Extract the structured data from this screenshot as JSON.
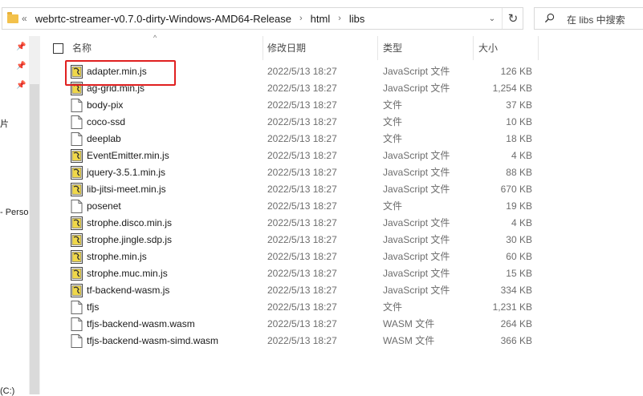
{
  "address_bar": {
    "overflow_chevron": "«",
    "crumbs": [
      "webrtc-streamer-v0.7.0-dirty-Windows-AMD64-Release",
      "html",
      "libs"
    ],
    "separator": "›",
    "dropdown_glyph": "⌄",
    "refresh_glyph": "↻"
  },
  "search": {
    "placeholder": "在 libs 中搜索"
  },
  "nav": {
    "fragments": [
      "片",
      "- Perso",
      "(C:)"
    ]
  },
  "columns": {
    "name": "名称",
    "date": "修改日期",
    "type": "类型",
    "size": "大小"
  },
  "files": [
    {
      "name": "adapter.min.js",
      "date": "2022/5/13 18:27",
      "type": "JavaScript 文件",
      "size": "126 KB",
      "icon": "js"
    },
    {
      "name": "ag-grid.min.js",
      "date": "2022/5/13 18:27",
      "type": "JavaScript 文件",
      "size": "1,254 KB",
      "icon": "js"
    },
    {
      "name": "body-pix",
      "date": "2022/5/13 18:27",
      "type": "文件",
      "size": "37 KB",
      "icon": "file"
    },
    {
      "name": "coco-ssd",
      "date": "2022/5/13 18:27",
      "type": "文件",
      "size": "10 KB",
      "icon": "file"
    },
    {
      "name": "deeplab",
      "date": "2022/5/13 18:27",
      "type": "文件",
      "size": "18 KB",
      "icon": "file"
    },
    {
      "name": "EventEmitter.min.js",
      "date": "2022/5/13 18:27",
      "type": "JavaScript 文件",
      "size": "4 KB",
      "icon": "js"
    },
    {
      "name": "jquery-3.5.1.min.js",
      "date": "2022/5/13 18:27",
      "type": "JavaScript 文件",
      "size": "88 KB",
      "icon": "js"
    },
    {
      "name": "lib-jitsi-meet.min.js",
      "date": "2022/5/13 18:27",
      "type": "JavaScript 文件",
      "size": "670 KB",
      "icon": "js"
    },
    {
      "name": "posenet",
      "date": "2022/5/13 18:27",
      "type": "文件",
      "size": "19 KB",
      "icon": "file"
    },
    {
      "name": "strophe.disco.min.js",
      "date": "2022/5/13 18:27",
      "type": "JavaScript 文件",
      "size": "4 KB",
      "icon": "js"
    },
    {
      "name": "strophe.jingle.sdp.js",
      "date": "2022/5/13 18:27",
      "type": "JavaScript 文件",
      "size": "30 KB",
      "icon": "js"
    },
    {
      "name": "strophe.min.js",
      "date": "2022/5/13 18:27",
      "type": "JavaScript 文件",
      "size": "60 KB",
      "icon": "js"
    },
    {
      "name": "strophe.muc.min.js",
      "date": "2022/5/13 18:27",
      "type": "JavaScript 文件",
      "size": "15 KB",
      "icon": "js"
    },
    {
      "name": "tf-backend-wasm.js",
      "date": "2022/5/13 18:27",
      "type": "JavaScript 文件",
      "size": "334 KB",
      "icon": "js"
    },
    {
      "name": "tfjs",
      "date": "2022/5/13 18:27",
      "type": "文件",
      "size": "1,231 KB",
      "icon": "file"
    },
    {
      "name": "tfjs-backend-wasm.wasm",
      "date": "2022/5/13 18:27",
      "type": "WASM 文件",
      "size": "264 KB",
      "icon": "file"
    },
    {
      "name": "tfjs-backend-wasm-simd.wasm",
      "date": "2022/5/13 18:27",
      "type": "WASM 文件",
      "size": "366 KB",
      "icon": "file"
    }
  ],
  "highlighted_file": "adapter.min.js",
  "colors": {
    "highlight": "#e02020",
    "folder": "#f3c14b",
    "js_icon": "#f0d84a"
  }
}
